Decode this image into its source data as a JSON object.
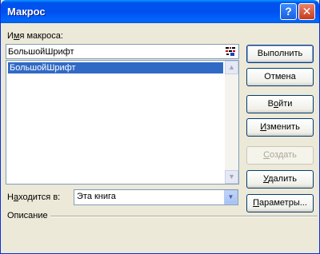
{
  "window": {
    "title": "Макрос",
    "help_glyph": "?",
    "close_glyph": "✕"
  },
  "macro_name": {
    "label_pre": "И",
    "label_key": "м",
    "label_post": "я макроса:",
    "value": "БольшойШрифт",
    "icon": "macro-record-icon"
  },
  "macro_list": {
    "items": [
      "БольшойШрифт"
    ],
    "selected": "БольшойШрифт"
  },
  "buttons": {
    "run": "Выполнить",
    "cancel": "Отмена",
    "step_into_pre": "В",
    "step_into_key": "о",
    "step_into_post": "йти",
    "edit_pre": "",
    "edit_key": "И",
    "edit_post": "зменить",
    "create_pre": "",
    "create_key": "С",
    "create_post": "оздать",
    "delete_pre": "",
    "delete_key": "У",
    "delete_post": "далить",
    "options_pre": "",
    "options_key": "П",
    "options_post": "араметры..."
  },
  "location": {
    "label_pre": "Н",
    "label_key": "а",
    "label_post": "ходится в:",
    "value": "Эта книга"
  },
  "description": {
    "label": "Описание",
    "text": ""
  },
  "colors": {
    "titlebar": "#0053EE",
    "face": "#ECE9D8",
    "selection": "#316AC5"
  }
}
